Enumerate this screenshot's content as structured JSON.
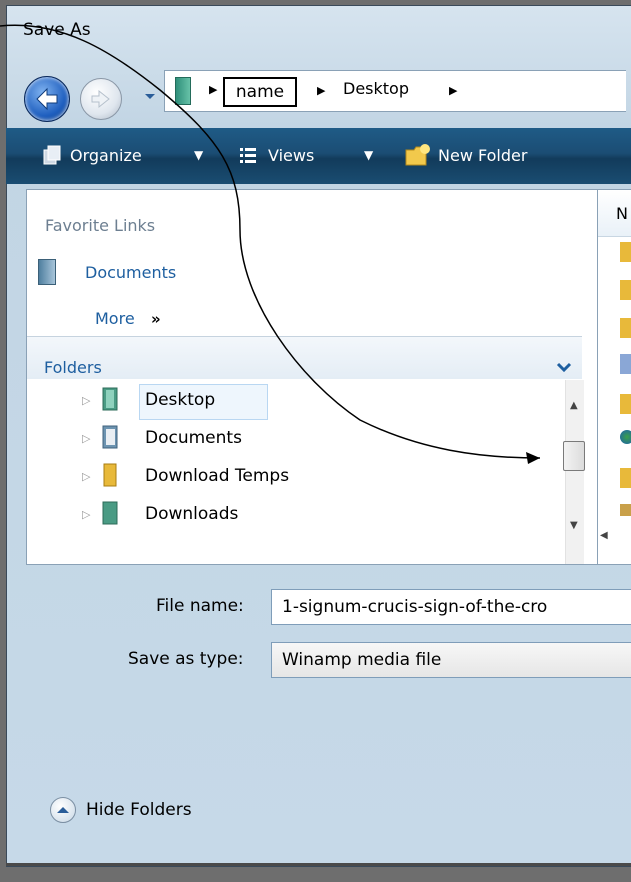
{
  "window": {
    "title": "Save As"
  },
  "address": {
    "crumbs": [
      "name",
      "Desktop"
    ]
  },
  "toolbar": {
    "organize": "Organize",
    "views": "Views",
    "new_folder": "New Folder"
  },
  "favorites": {
    "title": "Favorite Links",
    "items": [
      "Documents"
    ],
    "more": "More",
    "more_chevron": "»"
  },
  "folders": {
    "title": "Folders",
    "items": [
      {
        "label": "Desktop",
        "icon": "desktop-folder-icon",
        "selected": true
      },
      {
        "label": "Documents",
        "icon": "documents-folder-icon",
        "selected": false
      },
      {
        "label": "Download Temps",
        "icon": "folder-icon",
        "selected": false
      },
      {
        "label": "Downloads",
        "icon": "downloads-folder-icon",
        "selected": false
      }
    ]
  },
  "rightpane": {
    "header_letter": "N"
  },
  "form": {
    "file_name_label": "File name:",
    "file_name_value": "1-signum-crucis-sign-of-the-cro",
    "save_type_label": "Save as type:",
    "save_type_value": "Winamp media file"
  },
  "hide_folders": "Hide Folders",
  "colors": {
    "toolbar": "#1b4d74",
    "link": "#1e5fa0",
    "window_bg": "#c6d9e8"
  }
}
